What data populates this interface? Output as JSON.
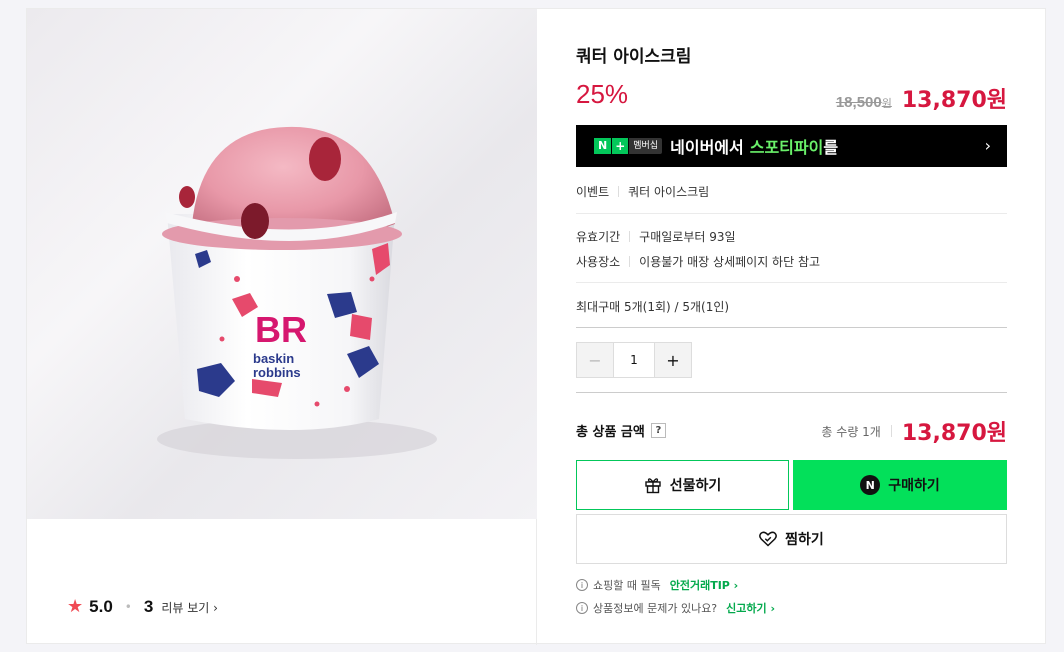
{
  "product": {
    "title": "쿼터 아이스크림",
    "discount": "25%",
    "original_price": "18,500",
    "original_unit": "원",
    "final_price": "13,870원"
  },
  "banner": {
    "badge_n": "N",
    "badge_plus": "+",
    "badge_member": "멤버십",
    "text_before": "네이버에서",
    "text_highlight": "스포티파이",
    "text_after": "를",
    "chevron": "›"
  },
  "info": {
    "event_label": "이벤트",
    "event_value": "쿼터 아이스크림",
    "validity_label": "유효기간",
    "validity_value": "구매일로부터 93일",
    "location_label": "사용장소",
    "location_value": "이용불가 매장 상세페이지 하단 참고",
    "max_purchase": "최대구매 5개(1회) / 5개(1인)"
  },
  "stepper": {
    "minus": "−",
    "value": "1",
    "plus": "+"
  },
  "total": {
    "label": "총 상품 금액",
    "help": "?",
    "qty_text": "총 수량 1개",
    "amount": "13,870원"
  },
  "buttons": {
    "gift": "선물하기",
    "buy": "구매하기",
    "buy_badge": "N",
    "wish": "찜하기"
  },
  "notices": {
    "n1_text": "쇼핑할 때 필독",
    "n1_link": "안전거래TIP ›",
    "n2_text": "상품정보에 문제가 있나요?",
    "n2_link": "신고하기 ›"
  },
  "rating": {
    "star": "★",
    "score": "5.0",
    "dot": "•",
    "count": "3",
    "review_link": "리뷰 보기 ›"
  },
  "logo": {
    "letters": "BR",
    "line1": "baskin",
    "line2": "robbins"
  },
  "colors": {
    "accent_red": "#d6173f",
    "naver_green": "#03c75a",
    "buy_green": "#03e05a"
  }
}
